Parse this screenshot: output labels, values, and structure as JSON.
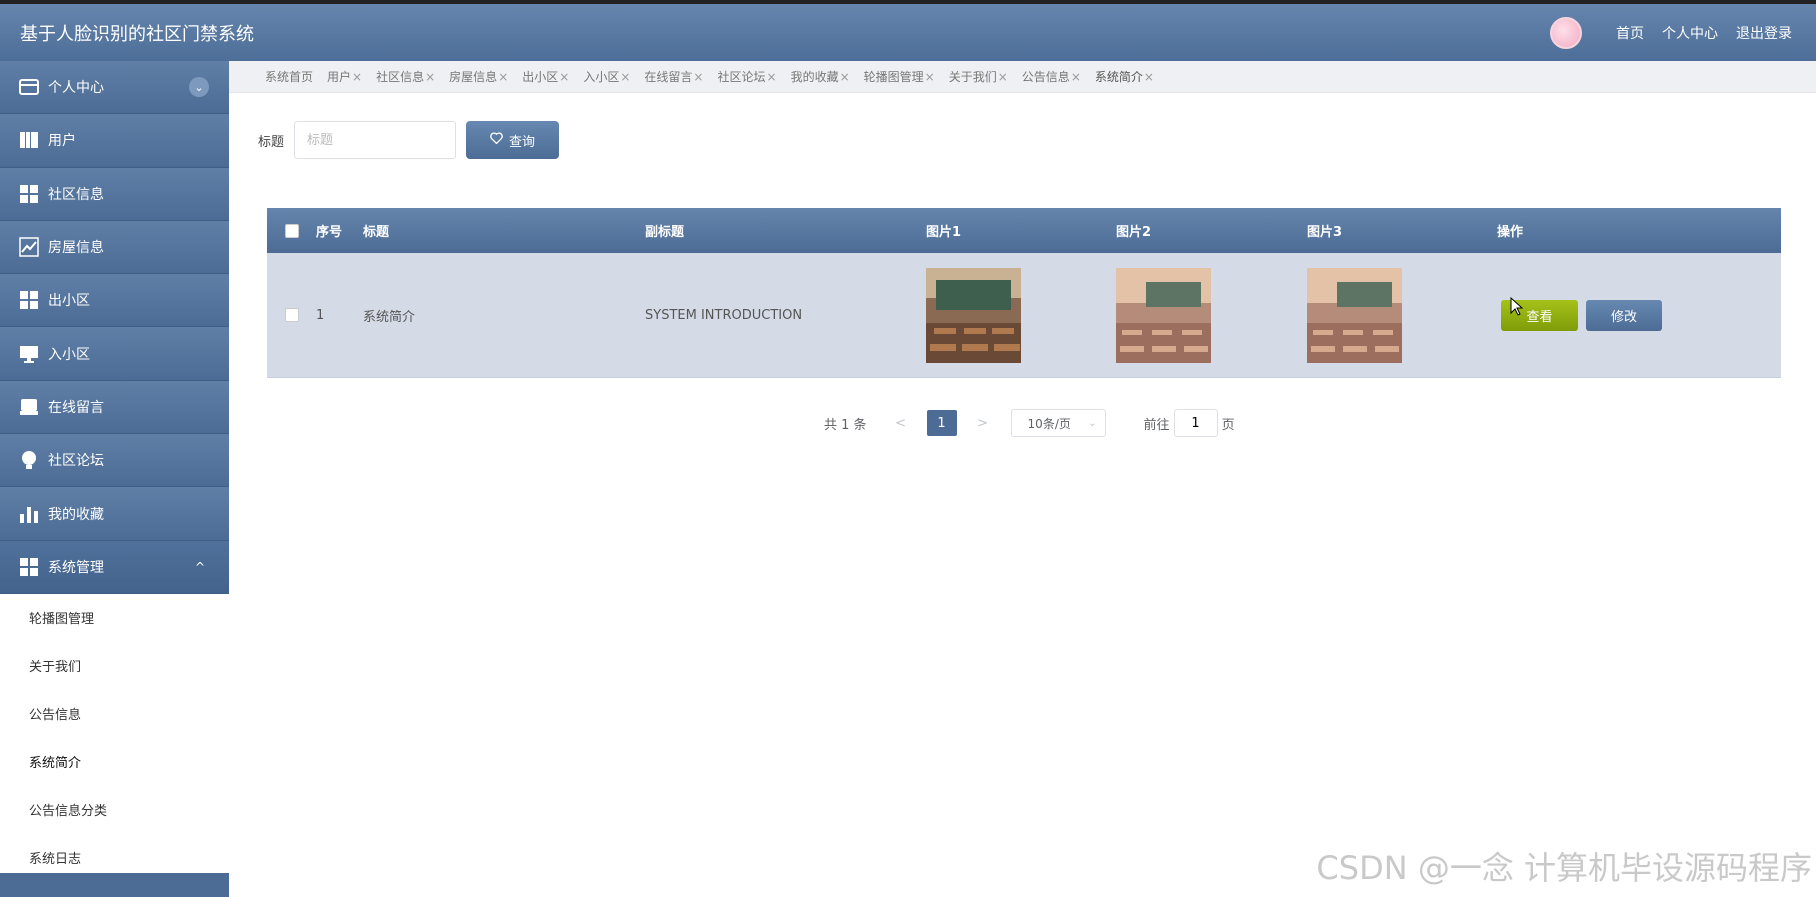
{
  "header": {
    "title": "基于人脸识别的社区门禁系统",
    "links": [
      "首页",
      "个人中心",
      "退出登录"
    ]
  },
  "sidebar": {
    "items": [
      {
        "label": "个人中心",
        "icon": "wallet-icon"
      },
      {
        "label": "用户",
        "icon": "book-icon"
      },
      {
        "label": "社区信息",
        "icon": "grid-icon"
      },
      {
        "label": "房屋信息",
        "icon": "chart-line-icon"
      },
      {
        "label": "出小区",
        "icon": "grid-icon"
      },
      {
        "label": "入小区",
        "icon": "monitor-icon"
      },
      {
        "label": "在线留言",
        "icon": "inbox-icon"
      },
      {
        "label": "社区论坛",
        "icon": "bulb-icon"
      },
      {
        "label": "我的收藏",
        "icon": "bar-chart-icon"
      },
      {
        "label": "系统管理",
        "icon": "grid-icon"
      }
    ],
    "sub_items": [
      "轮播图管理",
      "关于我们",
      "公告信息",
      "系统简介",
      "公告信息分类",
      "系统日志"
    ]
  },
  "tabs": [
    "系统首页",
    "用户",
    "社区信息",
    "房屋信息",
    "出小区",
    "入小区",
    "在线留言",
    "社区论坛",
    "我的收藏",
    "轮播图管理",
    "关于我们",
    "公告信息",
    "系统简介"
  ],
  "search": {
    "label": "标题",
    "placeholder": "标题",
    "button": "查询"
  },
  "table": {
    "headers": [
      "序号",
      "标题",
      "副标题",
      "图片1",
      "图片2",
      "图片3",
      "操作"
    ],
    "rows": [
      {
        "index": "1",
        "title": "系统简介",
        "subtitle": "SYSTEM INTRODUCTION"
      }
    ],
    "view_button": "查看",
    "edit_button": "修改"
  },
  "pagination": {
    "total": "共 1 条",
    "prev": "<",
    "next": ">",
    "current": "1",
    "page_size": "10条/页",
    "goto_prefix": "前往",
    "goto_value": "1",
    "goto_suffix": "页"
  },
  "watermark": "CSDN @一念 计算机毕设源码程序",
  "colors": {
    "primary": "#4c6c95",
    "view_button": "#93b012"
  }
}
